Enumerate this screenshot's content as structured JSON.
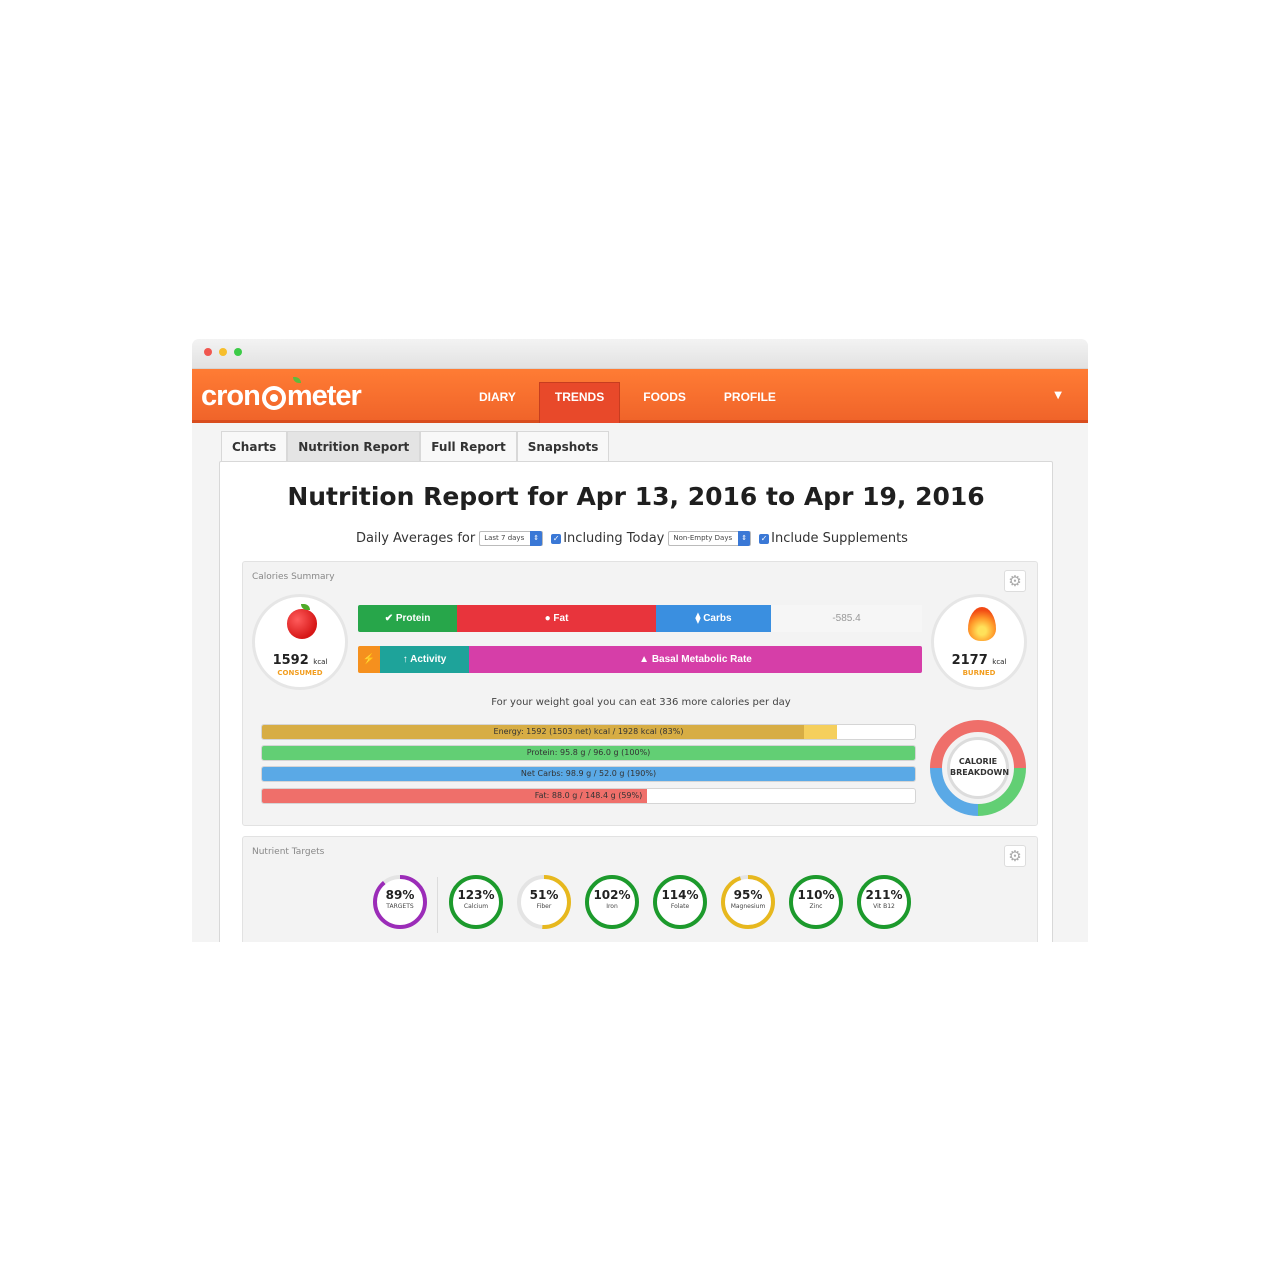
{
  "nav": {
    "logo_left": "cron",
    "logo_right": "meter",
    "items": [
      {
        "label": "DIARY"
      },
      {
        "label": "TRENDS",
        "active": true
      },
      {
        "label": "FOODS"
      },
      {
        "label": "PROFILE"
      }
    ],
    "menu_caret": "▼"
  },
  "subtabs": [
    {
      "label": "Charts"
    },
    {
      "label": "Nutrition Report",
      "active": true
    },
    {
      "label": "Full Report"
    },
    {
      "label": "Snapshots"
    }
  ],
  "report": {
    "title": "Nutrition Report for Apr 13, 2016 to Apr 19, 2016",
    "daily_averages_label": "Daily Averages for",
    "range_select": "Last 7 days",
    "including_today": "Including Today",
    "days_select": "Non-Empty Days",
    "include_supplements": "Include Supplements"
  },
  "calories_summary": {
    "title": "Calories Summary",
    "consumed_value": "1592",
    "consumed_unit": "kcal",
    "consumed_label": "CONSUMED",
    "burned_value": "2177",
    "burned_unit": "kcal",
    "burned_label": "BURNED",
    "intake_bars": [
      {
        "label": "Protein",
        "icon": "✔",
        "color": "#27a64a"
      },
      {
        "label": "Fat",
        "icon": "💧",
        "color": "#e8343c"
      },
      {
        "label": "Carbs",
        "icon": "⧫",
        "color": "#3a8fe0"
      }
    ],
    "intake_deficit": "-585.4",
    "burn_bars": [
      {
        "label": "",
        "icon": "🏃",
        "color": "#f5901e"
      },
      {
        "label": "Activity",
        "icon": "↑",
        "color": "#1ea39a"
      },
      {
        "label": "Basal Metabolic Rate",
        "icon": "🔥",
        "color": "#d63ea8"
      }
    ],
    "goal_text": "For your weight goal you can eat 336 more calories per day",
    "macro_targets": [
      {
        "label": "Energy: 1592 (1503 net) kcal / 1928 kcal (83%)",
        "percent": 83,
        "color": "#d7ad44",
        "extra_color": "#f5cf5c"
      },
      {
        "label": "Protein: 95.8 g / 96.0 g (100%)",
        "percent": 100,
        "color": "#62cf74"
      },
      {
        "label": "Net Carbs: 98.9 g / 52.0 g (190%)",
        "percent": 100,
        "color": "#5aa9e6"
      },
      {
        "label": "Fat: 88.0 g / 148.4 g (59%)",
        "percent": 59,
        "color": "#ef6f6a"
      }
    ],
    "breakdown_label_1": "CALORIE",
    "breakdown_label_2": "BREAKDOWN"
  },
  "nutrient_targets": {
    "title": "Nutrient Targets",
    "items": [
      {
        "pct": "89%",
        "label": "TARGETS",
        "value": 89,
        "color": "#9b2cb8"
      },
      {
        "pct": "123%",
        "label": "Calcium",
        "value": 100,
        "color": "#1c9a2c"
      },
      {
        "pct": "51%",
        "label": "Fiber",
        "value": 51,
        "color": "#e7b81e"
      },
      {
        "pct": "102%",
        "label": "Iron",
        "value": 100,
        "color": "#1c9a2c"
      },
      {
        "pct": "114%",
        "label": "Folate",
        "value": 100,
        "color": "#1c9a2c"
      },
      {
        "pct": "95%",
        "label": "Magnesium",
        "value": 95,
        "color": "#e7b81e"
      },
      {
        "pct": "110%",
        "label": "Zinc",
        "value": 100,
        "color": "#1c9a2c"
      },
      {
        "pct": "211%",
        "label": "Vit B12",
        "value": 100,
        "color": "#1c9a2c"
      }
    ]
  }
}
